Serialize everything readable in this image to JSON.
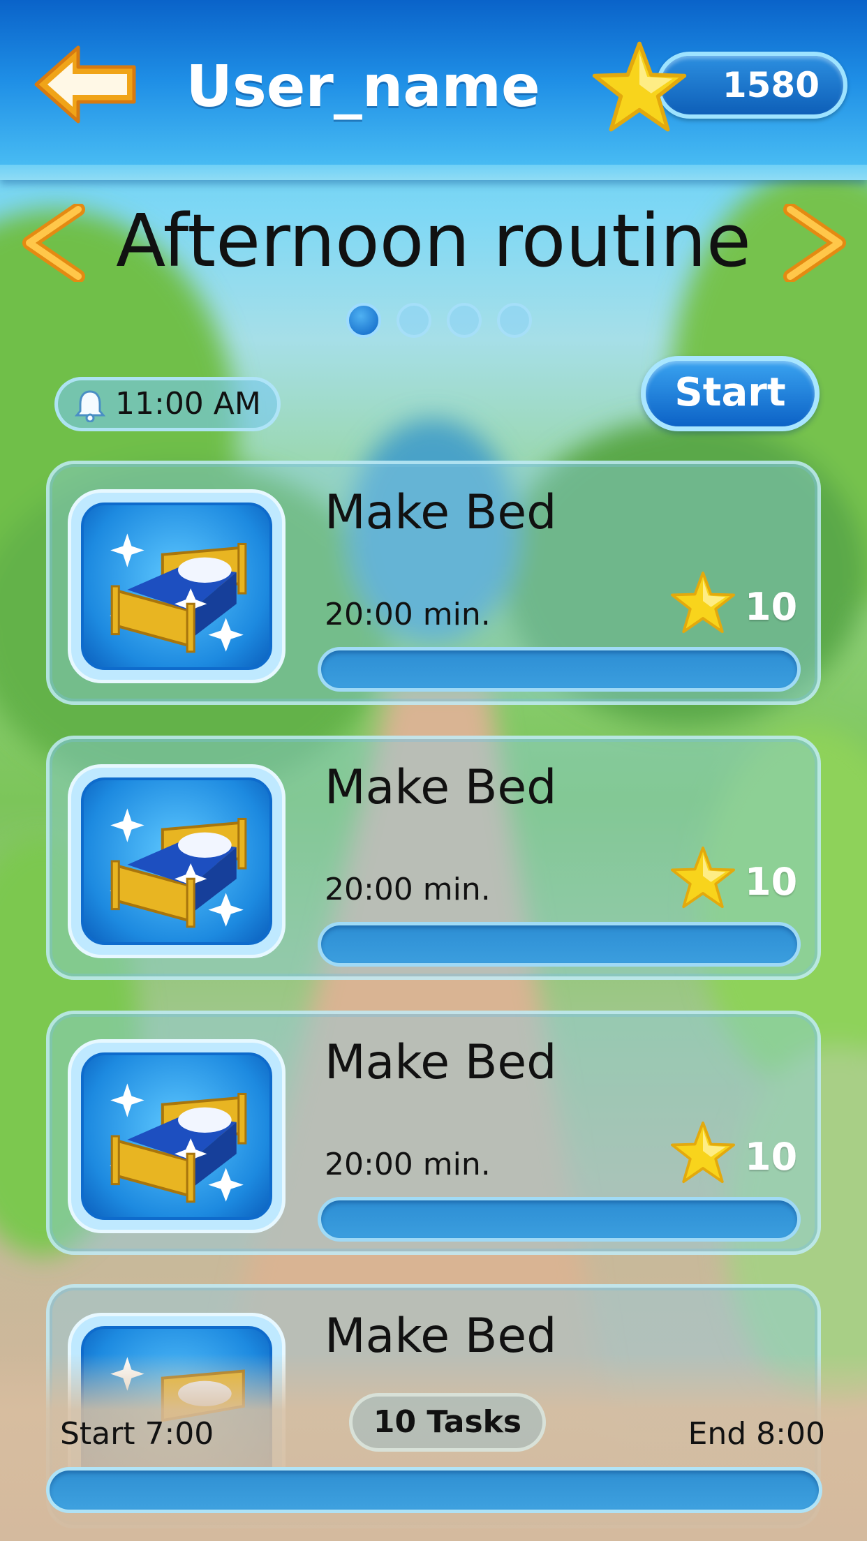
{
  "header": {
    "user_name": "User_name",
    "score": "1580",
    "back_icon": "arrow-left-icon",
    "score_icon": "star-icon"
  },
  "routine": {
    "title": "Afternoon routine",
    "pages_total": 4,
    "active_page": 1,
    "alarm_time": "11:00 AM",
    "start_label": "Start"
  },
  "tasks": [
    {
      "name": "Make Bed",
      "duration": "20:00 min.",
      "points": "10",
      "icon": "bed-icon"
    },
    {
      "name": "Make Bed",
      "duration": "20:00 min.",
      "points": "10",
      "icon": "bed-icon"
    },
    {
      "name": "Make Bed",
      "duration": "20:00 min.",
      "points": "10",
      "icon": "bed-icon"
    },
    {
      "name": "Make Bed",
      "icon": "bed-icon"
    }
  ],
  "footer": {
    "start_time": "Start 7:00",
    "task_count": "10 Tasks",
    "end_time": "End 8:00"
  },
  "colors": {
    "header_blue": "#1f8fe6",
    "button_blue": "#0c62c6",
    "star_yellow": "#f7d21a",
    "arrow_orange": "#f0a020"
  }
}
